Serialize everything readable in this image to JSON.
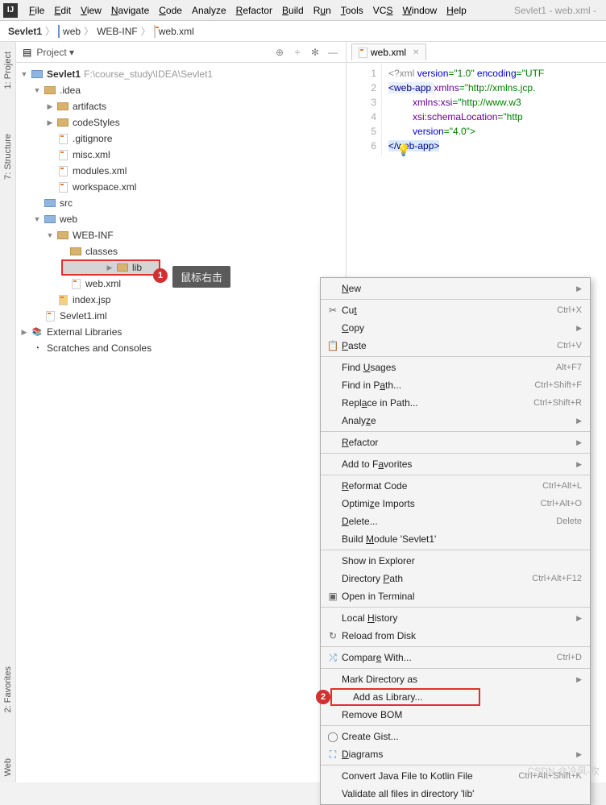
{
  "window": {
    "title": "Sevlet1 - web.xml -"
  },
  "menu": {
    "file": "File",
    "edit": "Edit",
    "view": "View",
    "navigate": "Navigate",
    "code": "Code",
    "analyze": "Analyze",
    "refactor": "Refactor",
    "build": "Build",
    "run": "Run",
    "tools": "Tools",
    "vcs": "VCS",
    "window": "Window",
    "help": "Help"
  },
  "breadcrumb": {
    "p0": "Sevlet1",
    "p1": "web",
    "p2": "WEB-INF",
    "p3": "web.xml"
  },
  "sidetabs": {
    "project": "1: Project",
    "structure": "7: Structure",
    "favorites": "2: Favorites",
    "web": "Web"
  },
  "panel": {
    "title": "Project"
  },
  "tree": {
    "root": "Sevlet1",
    "root_path": "F:\\course_study\\IDEA\\Sevlet1",
    "idea": ".idea",
    "artifacts": "artifacts",
    "codeStyles": "codeStyles",
    "gitignore": ".gitignore",
    "misc": "misc.xml",
    "modules": "modules.xml",
    "workspace": "workspace.xml",
    "src": "src",
    "web": "web",
    "webinf": "WEB-INF",
    "classes": "classes",
    "lib": "lib",
    "webxml": "web.xml",
    "index": "index.jsp",
    "iml": "Sevlet1.iml",
    "ext": "External Libraries",
    "scratches": "Scratches and Consoles"
  },
  "callouts": {
    "one": "1",
    "two": "2",
    "tip": "鼠标右击"
  },
  "editor": {
    "tab": "web.xml",
    "lines": {
      "l1": "1",
      "l2": "2",
      "l3": "3",
      "l4": "4",
      "l5": "5",
      "l6": "6"
    },
    "code": {
      "l1a": "<?xml ",
      "l1b": "version",
      "l1c": "=\"1.0\" ",
      "l1d": "encoding",
      "l1e": "=\"UTF",
      "l2a": "<web-app ",
      "l2b": "xmlns",
      "l2c": "=\"http://xmlns.jcp.",
      "l3a": "         ",
      "l3b": "xmlns:xsi",
      "l3c": "=\"http://www.w3",
      "l4a": "         ",
      "l4b": "xsi:schemaLocation",
      "l4c": "=\"http",
      "l5a": "         ",
      "l5b": "version",
      "l5c": "=\"4.0\">",
      "l6a": "</web-app>"
    }
  },
  "ctx": {
    "new": "New",
    "cut": "Cut",
    "cut_sc": "Ctrl+X",
    "copy": "Copy",
    "paste": "Paste",
    "paste_sc": "Ctrl+V",
    "find_usages": "Find Usages",
    "find_usages_sc": "Alt+F7",
    "find_path": "Find in Path...",
    "find_path_sc": "Ctrl+Shift+F",
    "replace_path": "Replace in Path...",
    "replace_path_sc": "Ctrl+Shift+R",
    "analyze": "Analyze",
    "refactor": "Refactor",
    "favorites": "Add to Favorites",
    "reformat": "Reformat Code",
    "reformat_sc": "Ctrl+Alt+L",
    "optimize": "Optimize Imports",
    "optimize_sc": "Ctrl+Alt+O",
    "delete": "Delete...",
    "delete_sc": "Delete",
    "build_module": "Build Module 'Sevlet1'",
    "show_explorer": "Show in Explorer",
    "dir_path": "Directory Path",
    "dir_path_sc": "Ctrl+Alt+F12",
    "open_terminal": "Open in Terminal",
    "local_history": "Local History",
    "reload": "Reload from Disk",
    "compare": "Compare With...",
    "compare_sc": "Ctrl+D",
    "mark_dir": "Mark Directory as",
    "add_lib": "Add as Library...",
    "remove_bom": "Remove BOM",
    "create_gist": "Create Gist...",
    "diagrams": "Diagrams",
    "convert_kotlin": "Convert Java File to Kotlin File",
    "convert_kotlin_sc": "Ctrl+Alt+Shift+K",
    "validate": "Validate all files in directory 'lib'"
  },
  "watermark": "CSDN @冷风-吹"
}
